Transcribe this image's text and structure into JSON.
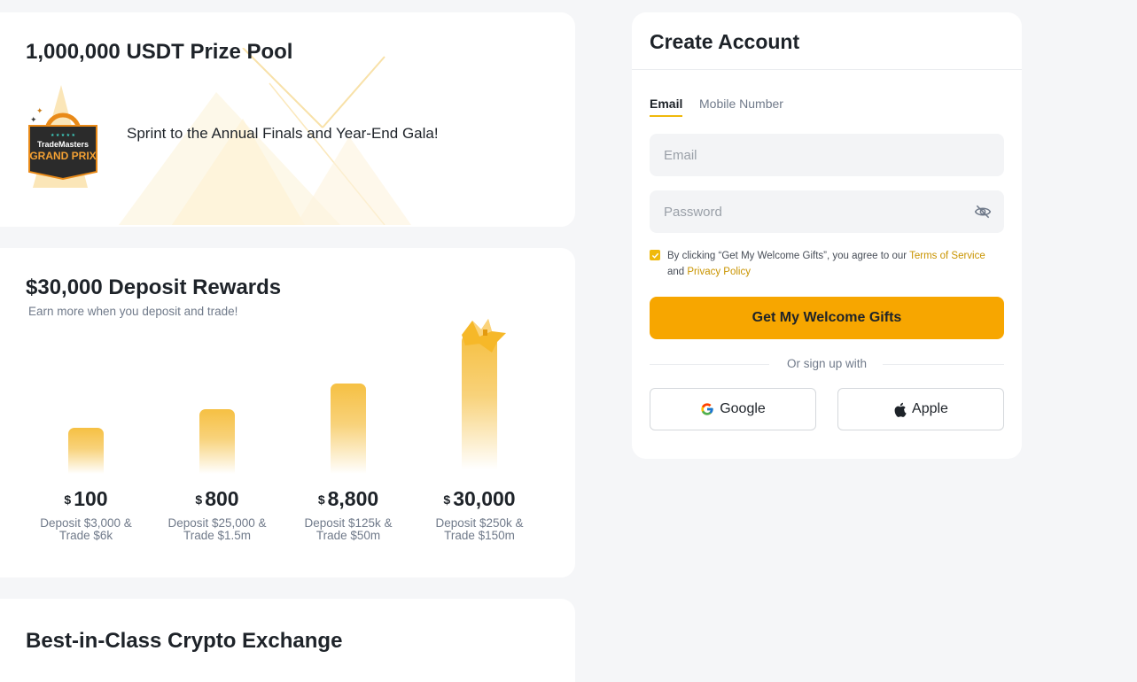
{
  "prize": {
    "title": "1,000,000 USDT Prize Pool",
    "subtitle": "Sprint to the Annual Finals and Year-End Gala!",
    "badge_line1": "TradeMasters",
    "badge_line2": "GRAND PRIX"
  },
  "deposit": {
    "title": "$30,000 Deposit Rewards",
    "subtitle": "Earn more when you deposit and trade!",
    "currency": "$",
    "tiers": [
      {
        "amount": "100",
        "desc1": "Deposit $3,000 &",
        "desc2": "Trade $6k"
      },
      {
        "amount": "800",
        "desc1": "Deposit $25,000 &",
        "desc2": "Trade $1.5m"
      },
      {
        "amount": "8,800",
        "desc1": "Deposit $125k &",
        "desc2": "Trade $50m"
      },
      {
        "amount": "30,000",
        "desc1": "Deposit $250k &",
        "desc2": "Trade $150m"
      }
    ]
  },
  "best": {
    "title": "Best-in-Class Crypto Exchange"
  },
  "signup": {
    "title": "Create Account",
    "tabs": {
      "email": "Email",
      "mobile": "Mobile Number"
    },
    "email_placeholder": "Email",
    "password_placeholder": "Password",
    "agree_prefix": "By clicking “Get My Welcome Gifts”, you agree to our ",
    "terms_link": "Terms of Service",
    "agree_and": "and ",
    "privacy_link": "Privacy Policy",
    "submit_label": "Get My Welcome Gifts",
    "or_label": "Or sign up with",
    "google_label": "Google",
    "apple_label": "Apple"
  },
  "colors": {
    "accent": "#f7a600",
    "link": "#c99400",
    "bar": "#f6c043"
  },
  "icons": [
    "trademasters-badge-icon",
    "crown-icon",
    "eye-off-icon",
    "checkbox-check-icon",
    "google-icon",
    "apple-icon"
  ]
}
